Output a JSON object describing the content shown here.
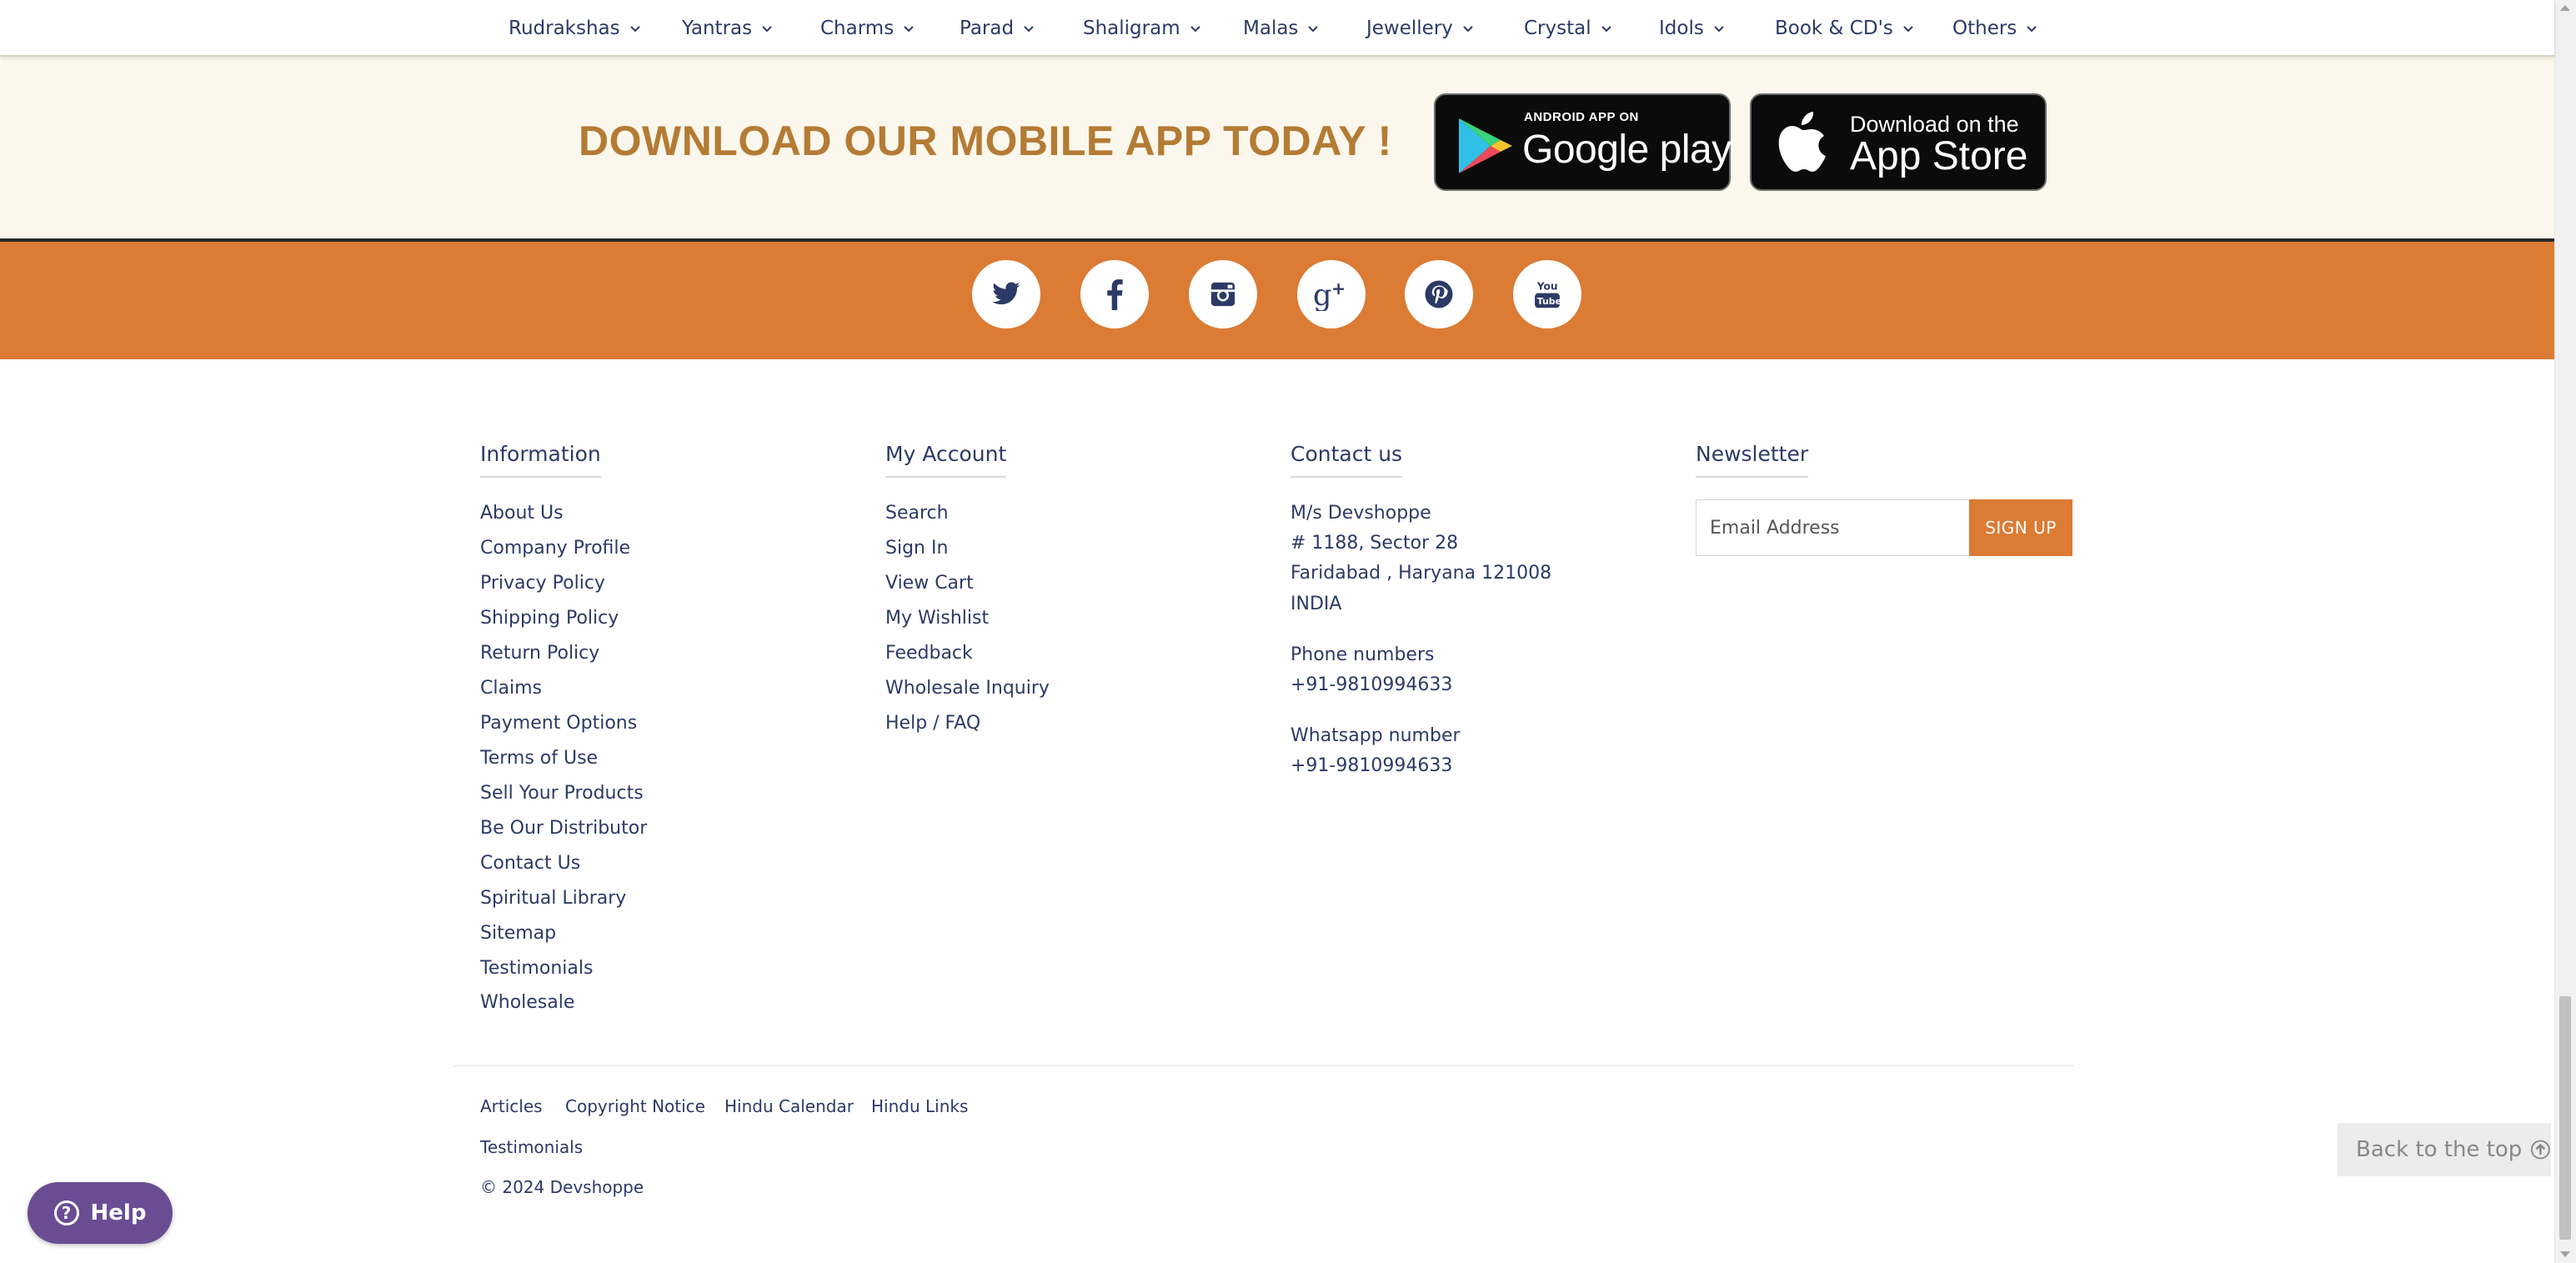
{
  "nav": {
    "items": [
      {
        "label": "Rudrakshas"
      },
      {
        "label": "Yantras"
      },
      {
        "label": "Charms"
      },
      {
        "label": "Parad"
      },
      {
        "label": "Shaligram"
      },
      {
        "label": "Malas"
      },
      {
        "label": "Jewellery"
      },
      {
        "label": "Crystal"
      },
      {
        "label": "Idols"
      },
      {
        "label": "Book & CD's"
      },
      {
        "label": "Others"
      }
    ]
  },
  "app_band": {
    "title": "DOWNLOAD OUR MOBILE APP TODAY !",
    "google": {
      "small": "ANDROID APP ON",
      "big": "Google play",
      "icon": "google-play-icon"
    },
    "apple": {
      "small": "Download on the",
      "big": "App Store",
      "icon": "apple-icon"
    }
  },
  "social": {
    "icons": [
      "twitter-icon",
      "facebook-icon",
      "instagram-icon",
      "google-plus-icon",
      "pinterest-icon",
      "youtube-icon"
    ]
  },
  "footer": {
    "information": {
      "heading": "Information",
      "links": [
        "About Us",
        "Company Profile",
        "Privacy Policy",
        "Shipping Policy",
        "Return Policy",
        "Claims",
        "Payment Options",
        "Terms of Use",
        "Sell Your Products",
        "Be Our Distributor",
        "Contact Us",
        "Spiritual Library",
        "Sitemap",
        "Testimonials",
        "Wholesale"
      ]
    },
    "account": {
      "heading": "My Account",
      "links": [
        "Search",
        "Sign In",
        "View Cart",
        "My Wishlist",
        "Feedback",
        "Wholesale Inquiry",
        "Help / FAQ"
      ]
    },
    "contact": {
      "heading": "Contact us",
      "address": [
        "M/s Devshoppe",
        "# 1188, Sector 28",
        "Faridabad , Haryana 121008",
        "INDIA"
      ],
      "phone_label": "Phone numbers",
      "phone": "+91-9810994633",
      "whatsapp_label": "Whatsapp number",
      "whatsapp": "+91-9810994633"
    },
    "newsletter": {
      "heading": "Newsletter",
      "placeholder": "Email Address",
      "button": "SIGN UP"
    },
    "bottom_links": [
      "Articles",
      "Copyright Notice",
      "Hindu Calendar",
      "Hindu Links",
      "Testimonials"
    ],
    "copyright": "© 2024 Devshoppe"
  },
  "widgets": {
    "help": "Help",
    "back_to_top": "Back to the top"
  },
  "colors": {
    "orange": "#db7b34",
    "gold_title": "#b47b34",
    "navy_text": "#2c3a66",
    "cream": "#fbf7ec",
    "help_purple": "#6a4c93"
  }
}
